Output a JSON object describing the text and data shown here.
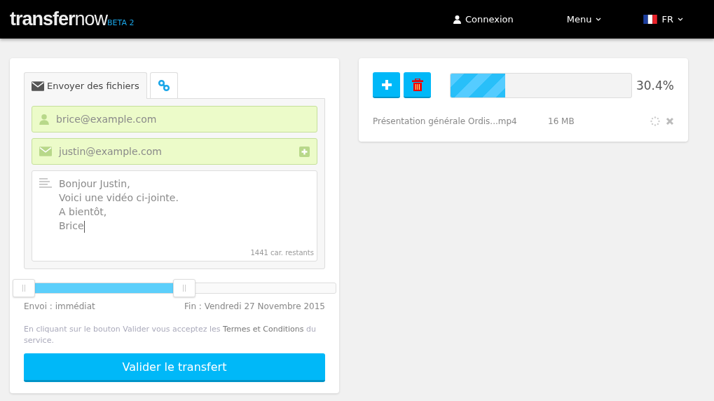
{
  "navbar": {
    "logo_bold": "transfer",
    "logo_light": "now",
    "badge": "BETA 2",
    "items": [
      {
        "kind": "user",
        "label": "Connexion"
      },
      {
        "kind": "dropdown",
        "label": "Menu"
      },
      {
        "kind": "language",
        "label": "FR"
      }
    ]
  },
  "tabs": [
    {
      "kind": "mail",
      "label": "Envoyer des fichiers",
      "selected": true
    },
    {
      "kind": "link",
      "selected": false
    }
  ],
  "sender": {
    "value": "brice@example.com"
  },
  "recipient": {
    "value": "justin@example.com"
  },
  "message": {
    "lines": [
      "Bonjour Justin,",
      "Voici une vidéo ci-jointe.",
      "A bientôt,",
      "Brice"
    ],
    "counter": "1441 car. restants"
  },
  "schedule": {
    "level": 0.53,
    "start_label": "Envoi : immédiat",
    "end_label": "Fin : Vendredi 27 Novembre 2015"
  },
  "terms": {
    "before": "En cliquant sur le bouton Valider vous acceptez les",
    "link": "Termes et Conditions",
    "after": "du service."
  },
  "submit": "Valider le transfert",
  "upload": {
    "level": 0.304,
    "percent": "30.4%",
    "files": [
      {
        "name": "Présentation générale Ordis...mp4",
        "size": "16 MB"
      }
    ]
  }
}
